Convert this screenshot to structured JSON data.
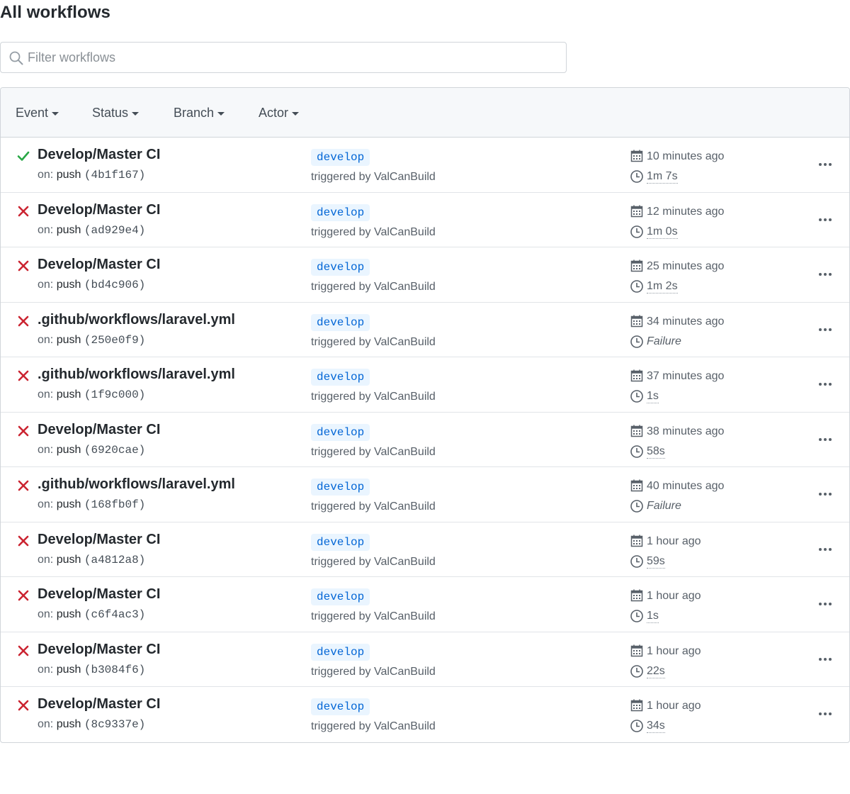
{
  "page": {
    "title": "All workflows"
  },
  "search": {
    "placeholder": "Filter workflows"
  },
  "filters": [
    {
      "label": "Event"
    },
    {
      "label": "Status"
    },
    {
      "label": "Branch"
    },
    {
      "label": "Actor"
    }
  ],
  "labels": {
    "on": "on:",
    "triggered_prefix": "triggered by"
  },
  "colors": {
    "success": "#28a745",
    "failure": "#cb2431",
    "branch_text": "#0366d6",
    "branch_bg": "#eaf5ff"
  },
  "runs": [
    {
      "status": "success",
      "status_icon": "check-icon",
      "name": "Develop/Master CI",
      "event": "push",
      "sha": "(4b1f167)",
      "branch": "develop",
      "actor": "ValCanBuild",
      "time_ago": "10 minutes ago",
      "duration": "1m 7s"
    },
    {
      "status": "failure",
      "status_icon": "x-icon",
      "name": "Develop/Master CI",
      "event": "push",
      "sha": "(ad929e4)",
      "branch": "develop",
      "actor": "ValCanBuild",
      "time_ago": "12 minutes ago",
      "duration": "1m 0s"
    },
    {
      "status": "failure",
      "status_icon": "x-icon",
      "name": "Develop/Master CI",
      "event": "push",
      "sha": "(bd4c906)",
      "branch": "develop",
      "actor": "ValCanBuild",
      "time_ago": "25 minutes ago",
      "duration": "1m 2s"
    },
    {
      "status": "failure",
      "status_icon": "x-icon",
      "name": ".github/workflows/laravel.yml",
      "event": "push",
      "sha": "(250e0f9)",
      "branch": "develop",
      "actor": "ValCanBuild",
      "time_ago": "34 minutes ago",
      "duration": "Failure"
    },
    {
      "status": "failure",
      "status_icon": "x-icon",
      "name": ".github/workflows/laravel.yml",
      "event": "push",
      "sha": "(1f9c000)",
      "branch": "develop",
      "actor": "ValCanBuild",
      "time_ago": "37 minutes ago",
      "duration": "1s"
    },
    {
      "status": "failure",
      "status_icon": "x-icon",
      "name": "Develop/Master CI",
      "event": "push",
      "sha": "(6920cae)",
      "branch": "develop",
      "actor": "ValCanBuild",
      "time_ago": "38 minutes ago",
      "duration": "58s"
    },
    {
      "status": "failure",
      "status_icon": "x-icon",
      "name": ".github/workflows/laravel.yml",
      "event": "push",
      "sha": "(168fb0f)",
      "branch": "develop",
      "actor": "ValCanBuild",
      "time_ago": "40 minutes ago",
      "duration": "Failure"
    },
    {
      "status": "failure",
      "status_icon": "x-icon",
      "name": "Develop/Master CI",
      "event": "push",
      "sha": "(a4812a8)",
      "branch": "develop",
      "actor": "ValCanBuild",
      "time_ago": "1 hour ago",
      "duration": "59s"
    },
    {
      "status": "failure",
      "status_icon": "x-icon",
      "name": "Develop/Master CI",
      "event": "push",
      "sha": "(c6f4ac3)",
      "branch": "develop",
      "actor": "ValCanBuild",
      "time_ago": "1 hour ago",
      "duration": "1s"
    },
    {
      "status": "failure",
      "status_icon": "x-icon",
      "name": "Develop/Master CI",
      "event": "push",
      "sha": "(b3084f6)",
      "branch": "develop",
      "actor": "ValCanBuild",
      "time_ago": "1 hour ago",
      "duration": "22s"
    },
    {
      "status": "failure",
      "status_icon": "x-icon",
      "name": "Develop/Master CI",
      "event": "push",
      "sha": "(8c9337e)",
      "branch": "develop",
      "actor": "ValCanBuild",
      "time_ago": "1 hour ago",
      "duration": "34s"
    }
  ]
}
